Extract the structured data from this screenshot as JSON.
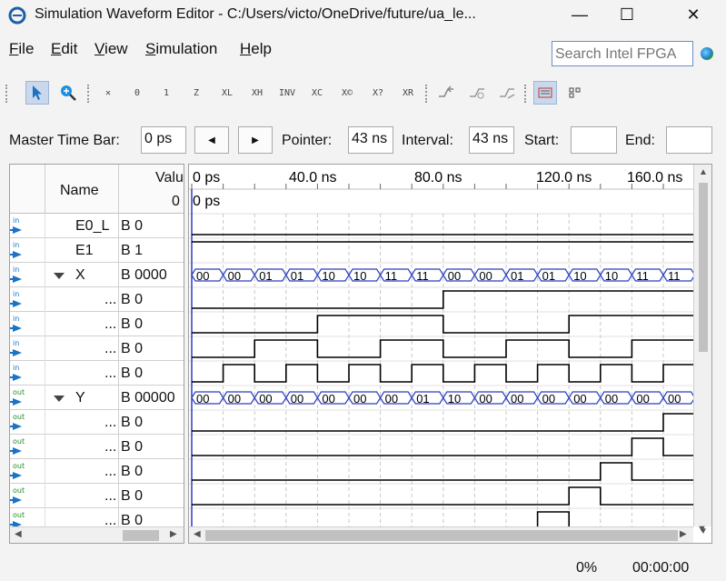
{
  "window": {
    "title": "Simulation Waveform Editor - C:/Users/victo/OneDrive/future/ua_le...",
    "minimize_glyph": "—",
    "maximize_glyph": "☐",
    "close_glyph": "✕"
  },
  "menu": [
    {
      "hot": "F",
      "rest": "ile"
    },
    {
      "hot": "E",
      "rest": "dit"
    },
    {
      "hot": "V",
      "rest": "iew"
    },
    {
      "hot": "S",
      "rest": "imulation"
    },
    {
      "hot": "H",
      "rest": "elp"
    }
  ],
  "search": {
    "placeholder": "Search Intel FPGA"
  },
  "toolbar": {
    "icons": [
      "select-tool-icon",
      "zoom-tool-icon",
      "forcing-unknown-icon",
      "forcing-low-icon",
      "forcing-high-icon",
      "high-impedance-icon",
      "weak-low-icon",
      "weak-high-icon",
      "invert-icon",
      "count-value-icon",
      "clock-icon",
      "arbitrary-value-icon",
      "random-value-icon",
      "snap-to-grid-icon",
      "sort-icon",
      "group-icon",
      "ungroup-icon",
      "waveform-view-icon"
    ],
    "glyphs": [
      "",
      "",
      "✕",
      "0",
      "1",
      "Z",
      "XL",
      "XH",
      "INV",
      "XC",
      "X©",
      "X?",
      "XR",
      "",
      "",
      "",
      "",
      ""
    ]
  },
  "timebar": {
    "master_label": "Master Time Bar:",
    "master_value": "0 ps",
    "prev_glyph": "◀",
    "next_glyph": "▶",
    "pointer_label": "Pointer:",
    "pointer_value": "43 ns",
    "interval_label": "Interval:",
    "interval_value": "43 ns",
    "start_label": "Start:",
    "start_value": "",
    "end_label": "End:",
    "end_value": ""
  },
  "grid": {
    "name_header": "Name",
    "value_header": "Valu",
    "value_header_sub": "0",
    "time_labels": [
      "0 ps",
      "40.0 ns",
      "80.0 ns",
      "120.0 ns",
      "160.0 ns"
    ],
    "cursor_label": "0 ps"
  },
  "signals": [
    {
      "dir": "in",
      "name": "E0_L",
      "value": "B 0",
      "group": false
    },
    {
      "dir": "in",
      "name": "E1",
      "value": "B 1",
      "group": false
    },
    {
      "dir": "in",
      "name": "X",
      "value": "B 0000",
      "group": true
    },
    {
      "dir": "in",
      "name": "...",
      "value": "B 0",
      "group": false
    },
    {
      "dir": "in",
      "name": "...",
      "value": "B 0",
      "group": false
    },
    {
      "dir": "in",
      "name": "...",
      "value": "B 0",
      "group": false
    },
    {
      "dir": "in",
      "name": "...",
      "value": "B 0",
      "group": false
    },
    {
      "dir": "out",
      "name": "Y",
      "value": "B 00000",
      "group": true
    },
    {
      "dir": "out",
      "name": "...",
      "value": "B 0",
      "group": false
    },
    {
      "dir": "out",
      "name": "...",
      "value": "B 0",
      "group": false
    },
    {
      "dir": "out",
      "name": "...",
      "value": "B 0",
      "group": false
    },
    {
      "dir": "out",
      "name": "...",
      "value": "B 0",
      "group": false
    },
    {
      "dir": "out",
      "name": "...",
      "value": "B 0",
      "group": false
    }
  ],
  "waves": {
    "E0_L": [
      0,
      0,
      0,
      0,
      0,
      0,
      0,
      0,
      0,
      0,
      0,
      0,
      0,
      0,
      0,
      0
    ],
    "E1": [
      1,
      1,
      1,
      1,
      1,
      1,
      1,
      1,
      1,
      1,
      1,
      1,
      1,
      1,
      1,
      1
    ],
    "X_bus": [
      "00",
      "00",
      "01",
      "01",
      "10",
      "10",
      "11",
      "11",
      "00",
      "00",
      "01",
      "01",
      "10",
      "10",
      "11",
      "11"
    ],
    "X3": [
      0,
      0,
      0,
      0,
      0,
      0,
      0,
      0,
      1,
      1,
      1,
      1,
      1,
      1,
      1,
      1
    ],
    "X2": [
      0,
      0,
      0,
      0,
      1,
      1,
      1,
      1,
      0,
      0,
      0,
      0,
      1,
      1,
      1,
      1
    ],
    "X1": [
      0,
      0,
      1,
      1,
      0,
      0,
      1,
      1,
      0,
      0,
      1,
      1,
      0,
      0,
      1,
      1
    ],
    "X0": [
      0,
      1,
      0,
      1,
      0,
      1,
      0,
      1,
      0,
      1,
      0,
      1,
      0,
      1,
      0,
      1
    ],
    "Y_bus": [
      "00",
      "00",
      "00",
      "00",
      "00",
      "00",
      "00",
      "01",
      "10",
      "00",
      "00",
      "00",
      "00",
      "00",
      "00",
      "00"
    ],
    "Y4": [
      0,
      0,
      0,
      0,
      0,
      0,
      0,
      0,
      0,
      0,
      0,
      0,
      0,
      0,
      0,
      1
    ],
    "Y3": [
      0,
      0,
      0,
      0,
      0,
      0,
      0,
      0,
      0,
      0,
      0,
      0,
      0,
      0,
      1,
      0
    ],
    "Y2": [
      0,
      0,
      0,
      0,
      0,
      0,
      0,
      0,
      0,
      0,
      0,
      0,
      0,
      1,
      0,
      0
    ],
    "Y1": [
      0,
      0,
      0,
      0,
      0,
      0,
      0,
      0,
      0,
      0,
      0,
      0,
      1,
      0,
      0,
      0
    ],
    "Y0": [
      0,
      0,
      0,
      0,
      0,
      0,
      0,
      0,
      0,
      0,
      0,
      1,
      0,
      0,
      0,
      0
    ]
  },
  "status": {
    "progress": "0%",
    "elapsed": "00:00:00"
  }
}
